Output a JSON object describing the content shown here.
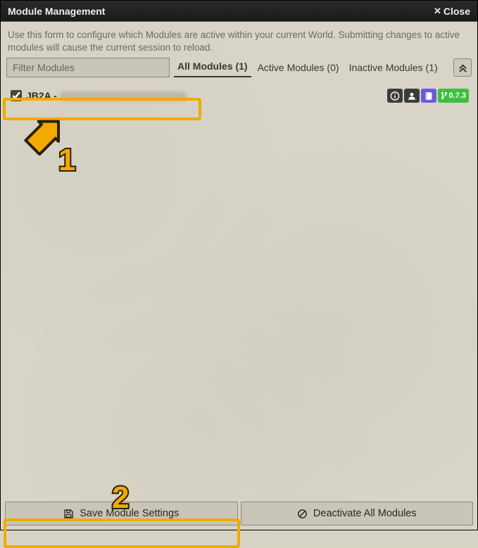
{
  "window": {
    "title": "Module Management",
    "close_label": "Close"
  },
  "description": "Use this form to configure which Modules are active within your current World. Submitting changes to active modules will cause the current session to reload.",
  "filter": {
    "placeholder": "Filter Modules"
  },
  "tabs": {
    "all": {
      "label": "All Modules",
      "count": 1
    },
    "active": {
      "label": "Active Modules",
      "count": 0
    },
    "inactive": {
      "label": "Inactive Modules",
      "count": 1
    }
  },
  "modules": [
    {
      "checked": true,
      "name": "JB2A -",
      "badges": {
        "version": "0.7.3"
      }
    }
  ],
  "footer": {
    "save_label": "Save Module Settings",
    "deactivate_label": "Deactivate All Modules"
  },
  "annotations": {
    "step1": "1",
    "step2": "2"
  }
}
